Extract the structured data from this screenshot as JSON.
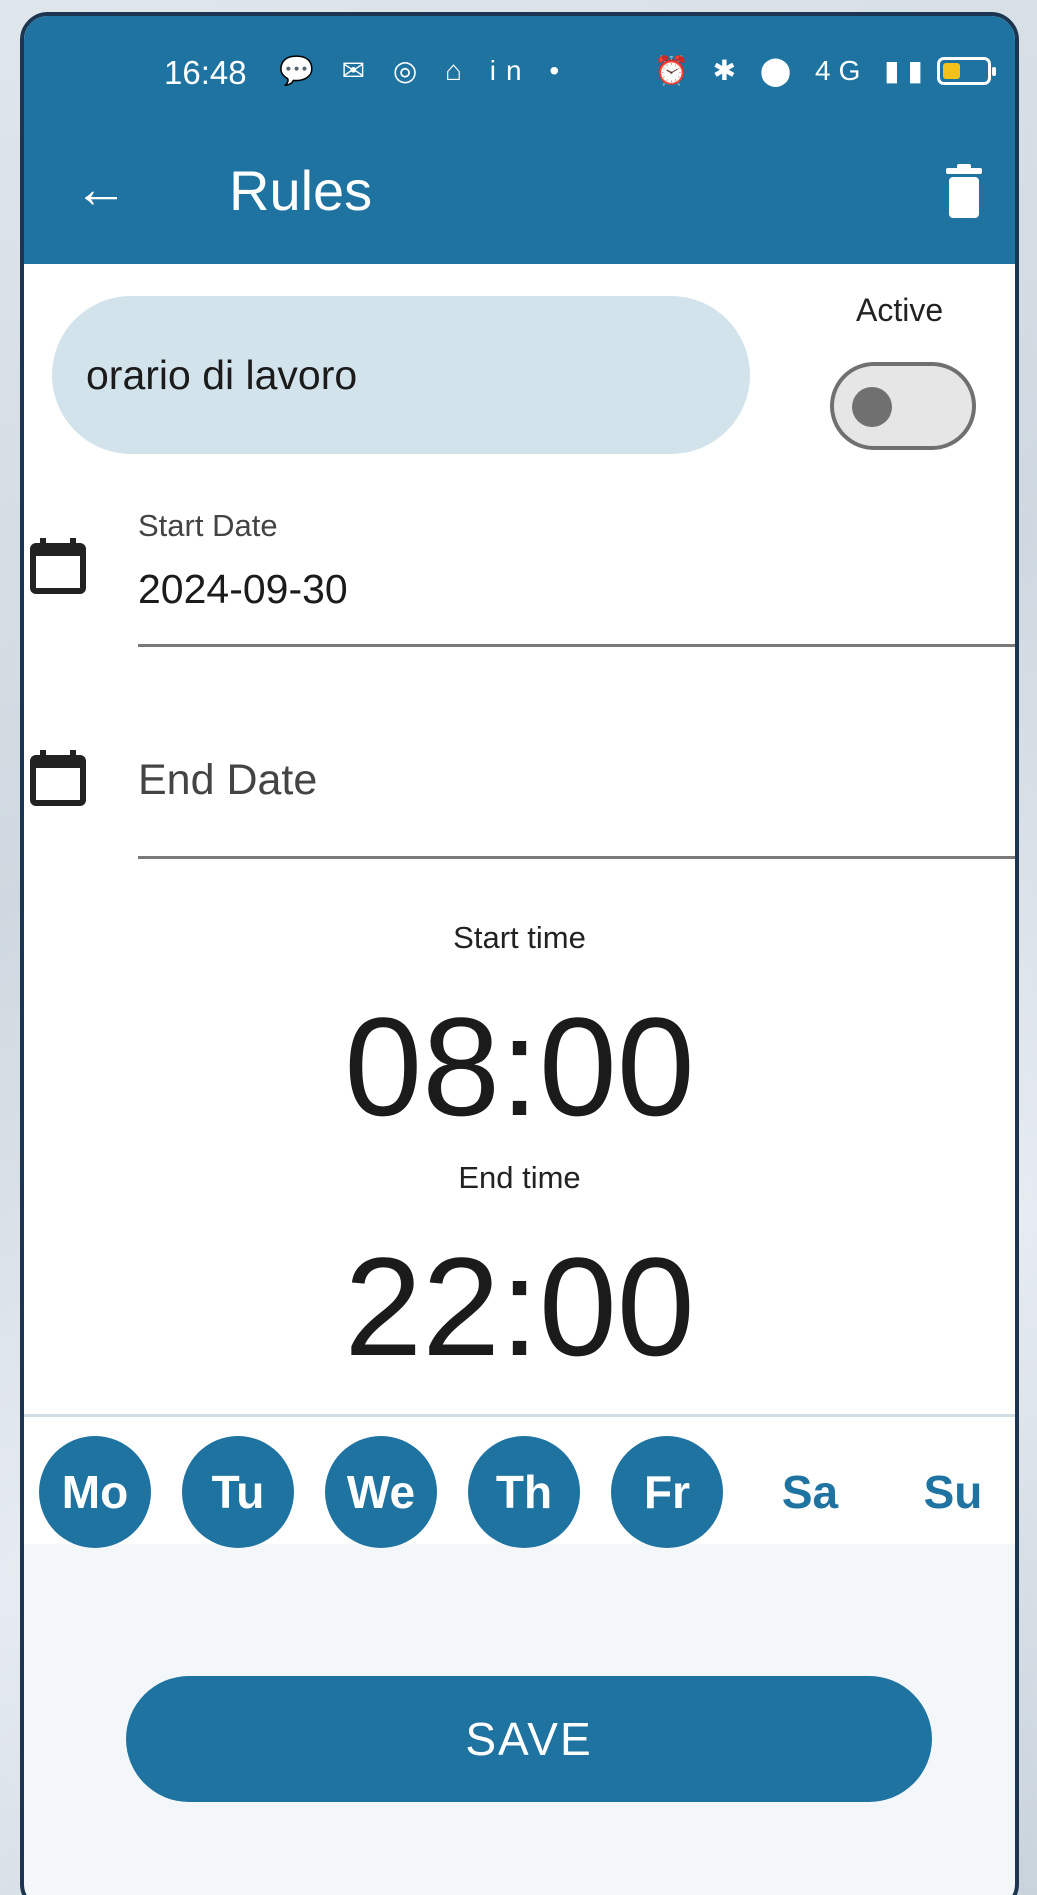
{
  "status_bar": {
    "time": "16:48",
    "left_icons": "💬 ✉ ◎ ⌂ in •",
    "right_icons": "⏰ ✱ ⬤ 4G ▮▮",
    "battery_level": 0.35
  },
  "appbar": {
    "title": "Rules",
    "back_icon": "arrow-left-icon",
    "delete_icon": "trash-icon"
  },
  "rule": {
    "name": "orario di lavoro",
    "active_label": "Active",
    "active": false
  },
  "start_date": {
    "label": "Start Date",
    "value": "2024-09-30"
  },
  "end_date": {
    "placeholder": "End Date"
  },
  "start_time": {
    "label": "Start time",
    "value": "08:00"
  },
  "end_time": {
    "label": "End time",
    "value": "22:00"
  },
  "days": [
    {
      "label": "Mo",
      "selected": true
    },
    {
      "label": "Tu",
      "selected": true
    },
    {
      "label": "We",
      "selected": true
    },
    {
      "label": "Th",
      "selected": true
    },
    {
      "label": "Fr",
      "selected": true
    },
    {
      "label": "Sa",
      "selected": false
    },
    {
      "label": "Su",
      "selected": false
    }
  ],
  "save_label": "SAVE",
  "colors": {
    "primary": "#1f73a0",
    "field_bg": "#d3e3ec"
  }
}
